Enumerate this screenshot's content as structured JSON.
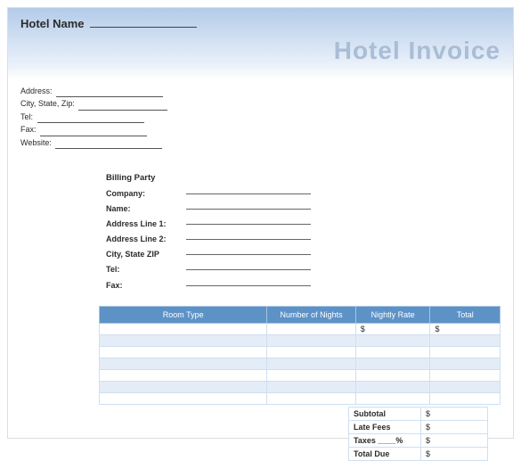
{
  "header": {
    "hotel_name_label": "Hotel Name",
    "invoice_title": "Hotel Invoice"
  },
  "contact": {
    "address_label": "Address:",
    "city_state_zip_label": "City, State, Zip:",
    "tel_label": "Tel:",
    "fax_label": "Fax:",
    "website_label": "Website:"
  },
  "billing": {
    "title": "Billing Party",
    "company_label": "Company:",
    "name_label": "Name:",
    "addr1_label": "Address Line 1:",
    "addr2_label": "Address Line 2:",
    "city_label": "City, State ZIP",
    "tel_label": "Tel:",
    "fax_label": "Fax:"
  },
  "table": {
    "headers": {
      "room_type": "Room Type",
      "nights": "Number of Nights",
      "rate": "Nightly Rate",
      "total": "Total"
    },
    "dollar": "$"
  },
  "totals": {
    "subtotal_label": "Subtotal",
    "late_fees_label": "Late Fees",
    "taxes_label": "Taxes ____%",
    "total_due_label": "Total Due",
    "dollar": "$"
  }
}
